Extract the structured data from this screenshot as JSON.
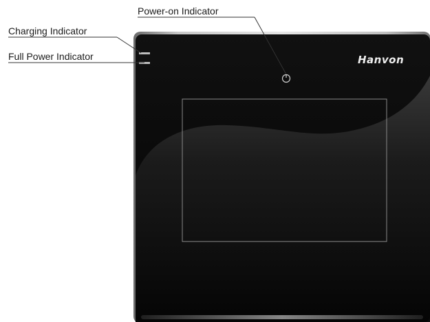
{
  "labels": {
    "power_on": "Power-on Indicator",
    "charging": "Charging Indicator",
    "full_power": "Full Power Indicator"
  },
  "device": {
    "brand": "Hanvon",
    "body_color": "#050505",
    "frame_color": "#9a9a9a",
    "work_area_border": "#8a8a8a",
    "led_color": "#bdbdbd"
  }
}
